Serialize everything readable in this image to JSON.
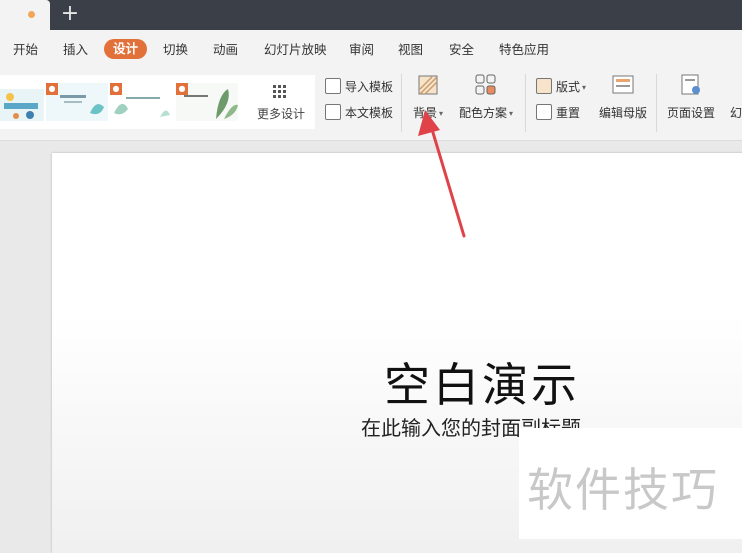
{
  "menu": {
    "items": [
      {
        "label": "开始"
      },
      {
        "label": "插入"
      },
      {
        "label": "设计"
      },
      {
        "label": "切换"
      },
      {
        "label": "动画"
      },
      {
        "label": "幻灯片放映"
      },
      {
        "label": "审阅"
      },
      {
        "label": "视图"
      },
      {
        "label": "安全"
      },
      {
        "label": "特色应用"
      }
    ],
    "active_tab": "设计"
  },
  "ribbon": {
    "more_design": "更多设计",
    "import_template": "导入模板",
    "this_template": "本文模板",
    "background": "背景",
    "color_scheme": "配色方案",
    "layout": "版式",
    "reset": "重置",
    "edit_master": "编辑母版",
    "page_setup": "页面设置",
    "cut_label": "幻"
  },
  "slide": {
    "title": "空白演示",
    "subtitle": "在此输入您的封面副标题"
  },
  "watermark": "软件技巧",
  "colors": {
    "accent": "#e2703a",
    "arrow": "#e0424a",
    "titlebar": "#3b3f47"
  }
}
